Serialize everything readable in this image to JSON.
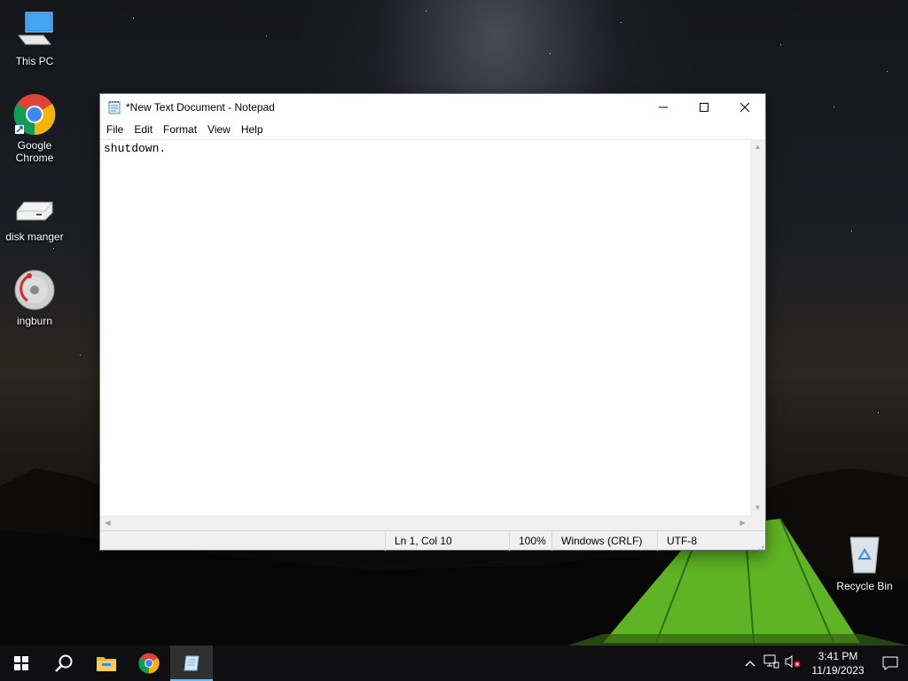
{
  "desktop": {
    "icons": [
      {
        "label": "This PC",
        "icon": "computer-icon"
      },
      {
        "label": "Google Chrome",
        "icon": "chrome-icon"
      },
      {
        "label": "disk manger",
        "icon": "drive-icon"
      },
      {
        "label": "ingburn",
        "icon": "disc-icon"
      },
      {
        "label": "Recycle Bin",
        "icon": "recycle-bin-icon"
      }
    ]
  },
  "window": {
    "title": "*New Text Document - Notepad",
    "menu": [
      "File",
      "Edit",
      "Format",
      "View",
      "Help"
    ],
    "content": "shutdown.",
    "status": {
      "position": "Ln 1, Col 10",
      "zoom": "100%",
      "line_ending": "Windows (CRLF)",
      "encoding": "UTF-8"
    }
  },
  "taskbar": {
    "apps": [
      "start-icon",
      "search-icon",
      "file-explorer-icon",
      "chrome-icon",
      "notepad-icon"
    ],
    "active_app": "notepad-icon",
    "clock": {
      "time": "3:41 PM",
      "date": "11/19/2023"
    }
  },
  "colors": {
    "accent": "#76b9ed",
    "taskbar": "#101012",
    "titlebar": "#ffffff"
  }
}
